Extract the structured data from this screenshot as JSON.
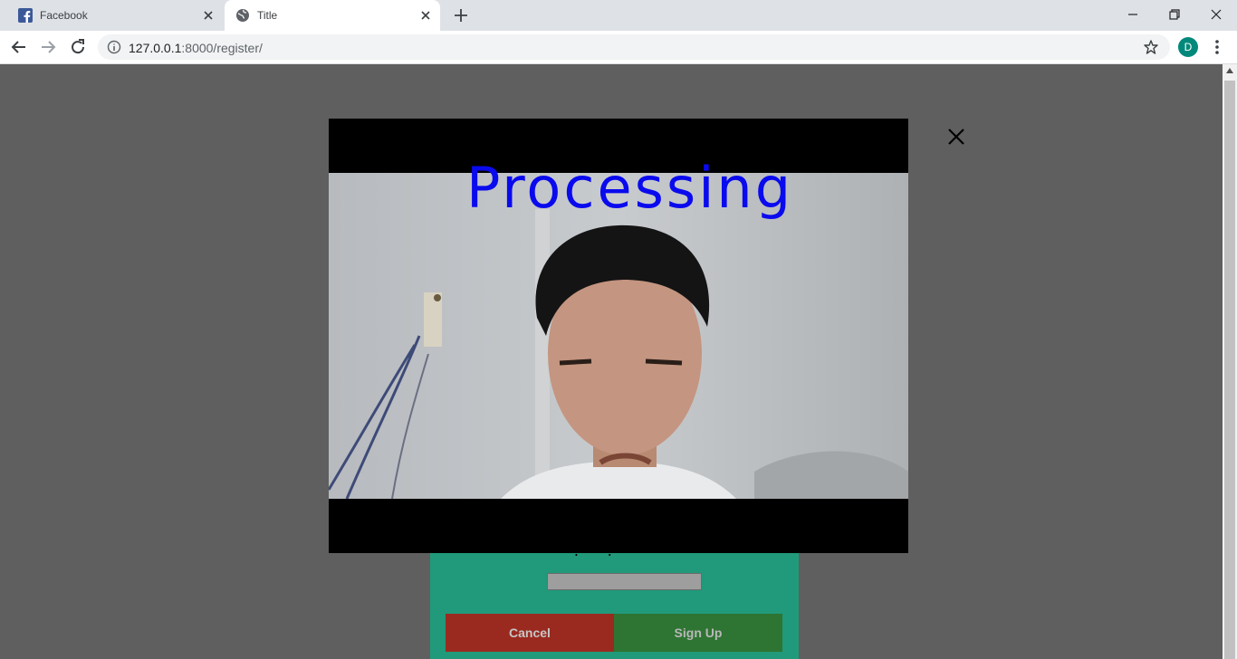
{
  "browser": {
    "tabs": [
      {
        "title": "Facebook",
        "favicon": "facebook-icon",
        "active": false
      },
      {
        "title": "Title",
        "favicon": "globe-icon",
        "active": true
      }
    ],
    "url_host": "127.0.0.1",
    "url_rest": ":8000/register/",
    "profile_initial": "D",
    "profile_color": "#00897b"
  },
  "page": {
    "overlay_text": "Processing",
    "overlay_text_color": "#0a0aee",
    "form": {
      "label": "Số điện thoại",
      "cancel_label": "Cancel",
      "signup_label": "Sign Up",
      "panel_color": "#209a7a",
      "cancel_color": "#9a2a20",
      "signup_color": "#2e7432"
    }
  }
}
